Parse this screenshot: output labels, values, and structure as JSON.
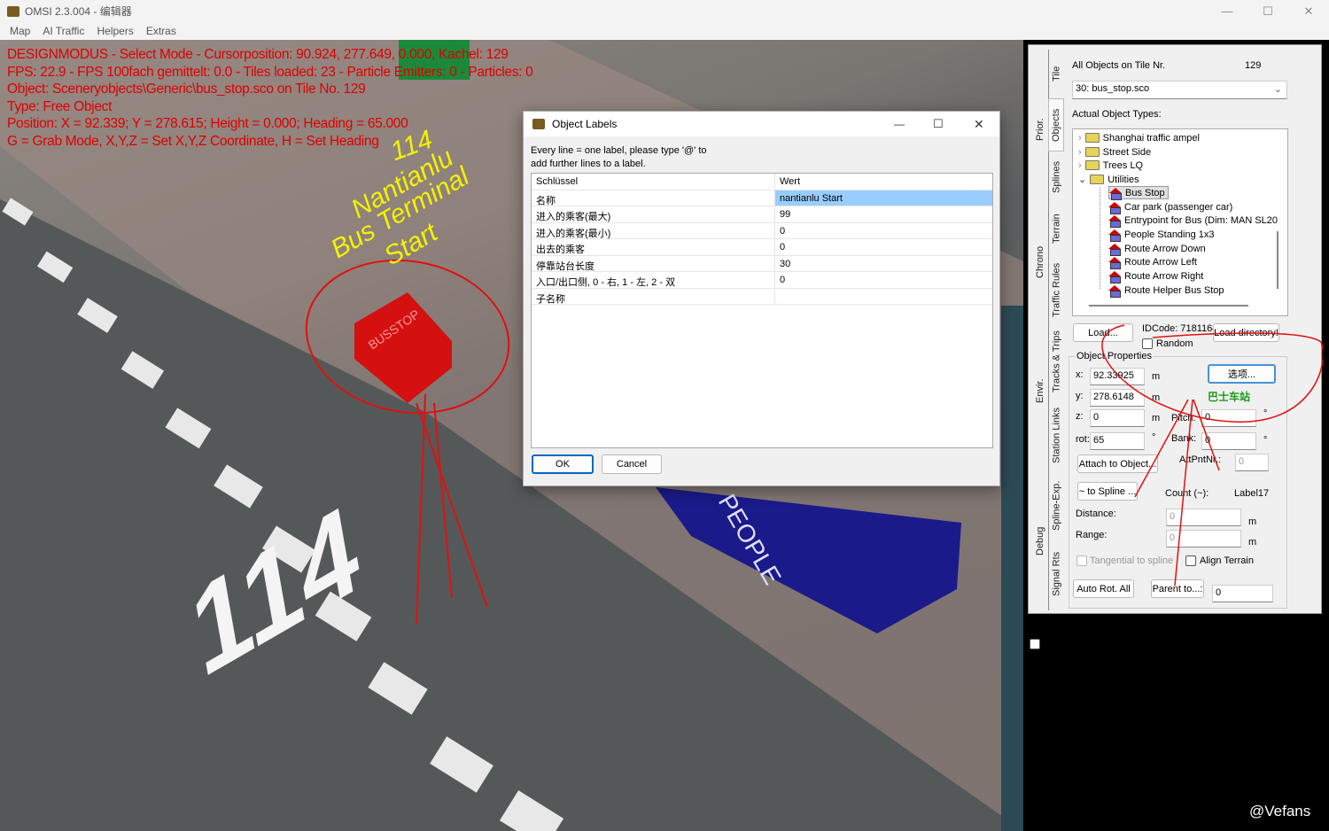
{
  "window": {
    "title": "OMSI 2.3.004 - 编辑器",
    "controls": [
      "—",
      "☐",
      "✕"
    ]
  },
  "menu": [
    "Map",
    "AI Traffic",
    "Helpers",
    "Extras"
  ],
  "overlay": {
    "lines": [
      "DESIGNMODUS - Select Mode - Cursorposition: 90.924, 277.649, 0.000, Kachel: 129",
      "FPS: 22.9 - FPS 100fach gemittelt: 0.0 - Tiles loaded: 23 - Particle Emitters: 0 - Particles: 0",
      "Object: Sceneryobjects\\Generic\\bus_stop.sco on Tile No. 129",
      "Type: Free Object",
      "Position: X = 92.339; Y = 278.615; Height = 0.000; Heading = 65.000",
      "G = Grab Mode, X,Y,Z = Set X,Y,Z Coordinate, H = Set Heading"
    ]
  },
  "annotation": {
    "l1": "114",
    "l2": "Nantianlu",
    "l3": "Bus Terminal",
    "l4": "Start",
    "cube_text": "BUSSTOP",
    "platform_text": "PEOPLE",
    "road_number": "114"
  },
  "dialog": {
    "title": "Object Labels",
    "hint1": "Every line = one label, please type '@' to",
    "hint2": "add further lines to a label.",
    "headers": [
      "Schlüssel",
      "Wert"
    ],
    "rows": [
      [
        "名称",
        "nantianlu Start"
      ],
      [
        "进入的乘客(最大)",
        "99"
      ],
      [
        "进入的乘客(最小)",
        "0"
      ],
      [
        "出去的乘客",
        "0"
      ],
      [
        "停靠站台长度",
        "30"
      ],
      [
        "入口/出口侧, 0 - 右, 1 - 左, 2 - 双",
        "0"
      ],
      [
        "子名称",
        ""
      ]
    ],
    "ok": "OK",
    "cancel": "Cancel"
  },
  "panel": {
    "outer_tabs": [
      "Prior.",
      "Chrono",
      "Envir.",
      "Debug"
    ],
    "inner_tabs": [
      "Tile",
      "Objects",
      "Splines",
      "Terrain",
      "Traffic Rules",
      "Tracks & Trips",
      "Station Links",
      "Spline-Exp.",
      "Signal Rts"
    ],
    "all_objects_label": "All Objects on Tile Nr.",
    "tile_no": "129",
    "object_select": "30: bus_stop.sco",
    "types_label": "Actual Object Types:",
    "folders": [
      "Shanghai traffic ampel",
      "Street Side",
      "Trees LQ",
      "Utilities"
    ],
    "items": [
      "Bus Stop",
      "Car park (passenger car)",
      "Entrypoint for Bus (Dim: MAN SL20",
      "People Standing 1x3",
      "Route Arrow Down",
      "Route Arrow Left",
      "Route Arrow Right",
      "Route Helper Bus Stop"
    ],
    "load": "Load...",
    "idcode": "IDCode: 7181164",
    "load_dir": "Load directory!",
    "random": "Random",
    "props_label": "Object Properties",
    "x_label": "x:",
    "x": "92.33925",
    "y_label": "y:",
    "y": "278.6148",
    "z_label": "z:",
    "z": "0",
    "rot_label": "rot:",
    "rot": "65",
    "unit_m": "m",
    "unit_deg": "°",
    "options": "选项...",
    "bus_stop_cn": "巴士车站",
    "pitch_label": "Pitch:",
    "pitch": "0",
    "bank_label": "Bank:",
    "bank": "0",
    "attach": "Attach to Object...",
    "attpnt_label": "AttPntNr.:",
    "attpnt": "0",
    "to_spline": "~ to Spline ...",
    "count_label": "Count (~):",
    "count_val": "Label17",
    "distance_label": "Distance:",
    "distance": "0",
    "range_label": "Range:",
    "range": "0",
    "tangential": "Tangential to spline",
    "align": "Align Terrain",
    "auto_rot": "Auto Rot. All",
    "parent": "Parent to...:",
    "parent_val": "0"
  },
  "watermark": "@Vefans"
}
